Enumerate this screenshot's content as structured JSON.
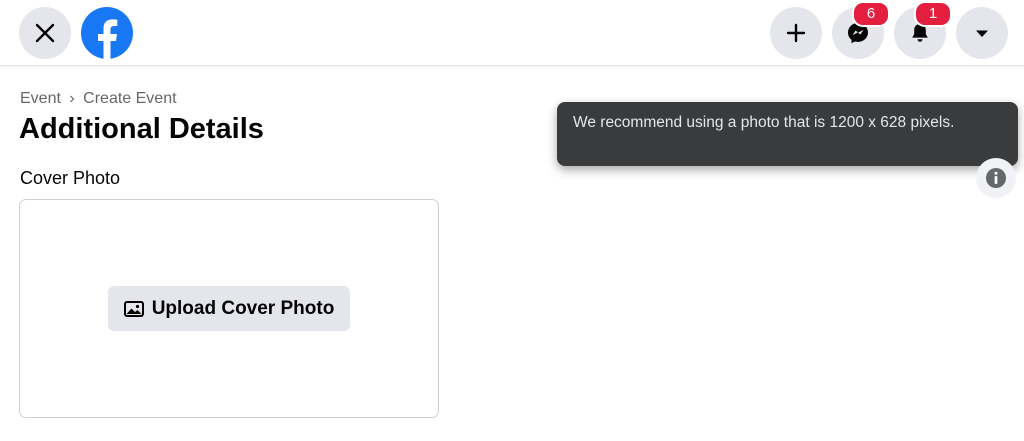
{
  "header": {
    "close_icon": "close-icon",
    "logo_icon": "facebook-logo",
    "create_icon": "plus-icon",
    "messenger_icon": "messenger-icon",
    "messenger_badge": "6",
    "notifications_icon": "bell-icon",
    "notifications_badge": "1",
    "account_icon": "caret-down-icon",
    "brand_color": "#1877f2",
    "badge_color": "#e41e3f"
  },
  "breadcrumb": {
    "parent": "Event",
    "separator": "›",
    "current": "Create Event"
  },
  "page": {
    "title": "Additional Details",
    "cover_label": "Cover Photo",
    "upload_label": "Upload Cover Photo",
    "upload_icon": "photo-icon"
  },
  "tooltip": {
    "text": "We recommend using a photo that is 1200 x 628 pixels."
  },
  "info_icon": "info-icon"
}
